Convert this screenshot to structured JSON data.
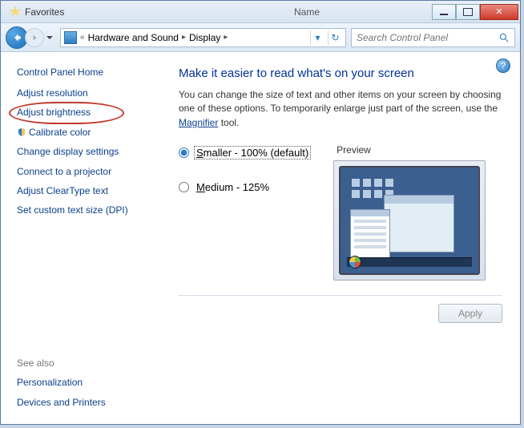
{
  "titlebar": {
    "favorites_label": "Favorites",
    "name_col": "Name"
  },
  "nav": {
    "breadcrumb_prefix": "«",
    "segment1": "Hardware and Sound",
    "segment2": "Display",
    "search_placeholder": "Search Control Panel"
  },
  "sidebar": {
    "home": "Control Panel Home",
    "links": [
      "Adjust resolution",
      "Adjust brightness",
      "Calibrate color",
      "Change display settings",
      "Connect to a projector",
      "Adjust ClearType text",
      "Set custom text size (DPI)"
    ],
    "see_also": "See also",
    "bottom_links": [
      "Personalization",
      "Devices and Printers"
    ]
  },
  "main": {
    "heading": "Make it easier to read what's on your screen",
    "description_pre": "You can change the size of text and other items on your screen by choosing one of these options. To temporarily enlarge just part of the screen, use the ",
    "description_link": "Magnifier",
    "description_post": " tool.",
    "options": [
      {
        "key": "S",
        "rest": "maller - 100% (default)",
        "selected": true
      },
      {
        "key": "M",
        "rest": "edium - 125%",
        "selected": false
      }
    ],
    "preview_label": "Preview",
    "apply_label": "Apply"
  }
}
